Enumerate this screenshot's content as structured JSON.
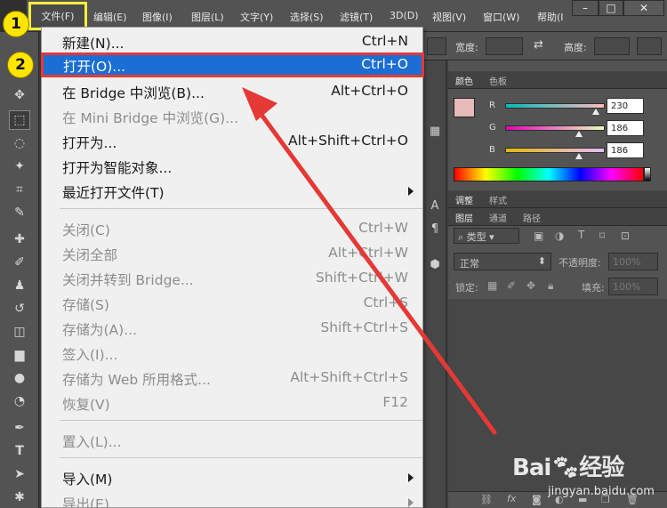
{
  "menubar": {
    "items": [
      "文件(F)",
      "编辑(E)",
      "图像(I)",
      "图层(L)",
      "文字(Y)",
      "选择(S)",
      "滤镜(T)",
      "3D(D)",
      "视图(V)",
      "窗口(W)",
      "帮助(I"
    ]
  },
  "window_controls": {
    "minimize": "–",
    "maximize": "□",
    "close": "✕"
  },
  "options_bar": {
    "width_label": "宽度:",
    "height_label": "高度:"
  },
  "file_menu": {
    "items": [
      {
        "label": "新建(N)...",
        "shortcut": "Ctrl+N"
      },
      {
        "label": "打开(O)...",
        "shortcut": "Ctrl+O"
      },
      {
        "label": "在 Bridge 中浏览(B)...",
        "shortcut": "Alt+Ctrl+O"
      },
      {
        "label": "在 Mini Bridge 中浏览(G)...",
        "shortcut": ""
      },
      {
        "label": "打开为...",
        "shortcut": "Alt+Shift+Ctrl+O"
      },
      {
        "label": "打开为智能对象...",
        "shortcut": ""
      },
      {
        "label": "最近打开文件(T)",
        "shortcut": ""
      },
      {
        "label": "关闭(C)",
        "shortcut": "Ctrl+W"
      },
      {
        "label": "关闭全部",
        "shortcut": "Alt+Ctrl+W"
      },
      {
        "label": "关闭并转到 Bridge...",
        "shortcut": "Shift+Ctrl+W"
      },
      {
        "label": "存储(S)",
        "shortcut": "Ctrl+S"
      },
      {
        "label": "存储为(A)...",
        "shortcut": "Shift+Ctrl+S"
      },
      {
        "label": "签入(I)...",
        "shortcut": ""
      },
      {
        "label": "存储为 Web 所用格式...",
        "shortcut": "Alt+Shift+Ctrl+S"
      },
      {
        "label": "恢复(V)",
        "shortcut": "F12"
      },
      {
        "label": "置入(L)...",
        "shortcut": ""
      },
      {
        "label": "导入(M)",
        "shortcut": ""
      },
      {
        "label": "导出(E)",
        "shortcut": ""
      }
    ]
  },
  "badges": {
    "step1": "1",
    "step2": "2"
  },
  "color_panel": {
    "tabs": [
      "颜色",
      "色板"
    ],
    "rows": [
      {
        "channel": "R",
        "value": "230"
      },
      {
        "channel": "G",
        "value": "186"
      },
      {
        "channel": "B",
        "value": "186"
      }
    ],
    "swatch": "#e6baba"
  },
  "adjust_panel": {
    "tabs": [
      "调整",
      "样式"
    ]
  },
  "layers_panel": {
    "tabs": [
      "图层",
      "通道",
      "路径"
    ],
    "filter_label": "类型",
    "blend_mode": "正常",
    "opacity_label": "不透明度:",
    "opacity_value": "100%",
    "lock_label": "锁定:",
    "fill_label": "填充:",
    "fill_value": "100%"
  },
  "watermark": {
    "brand": "Bai",
    "brand_cn": "经验",
    "url": "jingyan.baidu.com"
  },
  "colors": {
    "highlight": "#1b6ed4",
    "annotation_red": "#e53935",
    "badge_yellow": "#ffe500"
  }
}
